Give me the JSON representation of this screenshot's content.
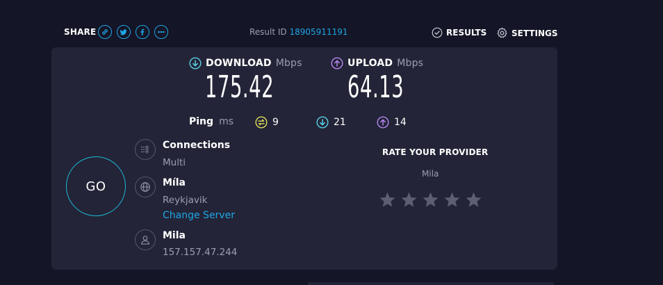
{
  "share": {
    "label": "SHARE",
    "buttons": [
      "link-icon",
      "twitter-icon",
      "facebook-icon",
      "more-icon"
    ]
  },
  "result": {
    "label": "Result ID",
    "id": "18905911191"
  },
  "nav": {
    "results": "RESULTS",
    "settings": "SETTINGS"
  },
  "download": {
    "label": "DOWNLOAD",
    "unit": "Mbps",
    "value": "175.42"
  },
  "upload": {
    "label": "UPLOAD",
    "unit": "Mbps",
    "value": "64.13"
  },
  "ping": {
    "label": "Ping",
    "unit": "ms",
    "idle": "9",
    "download": "21",
    "upload": "14"
  },
  "go_label": "GO",
  "connections": {
    "title": "Connections",
    "value": "Multi"
  },
  "server": {
    "name": "Míla",
    "location": "Reykjavik",
    "change_label": "Change Server"
  },
  "isp": {
    "name": "Mila",
    "ip": "157.157.47.244"
  },
  "rate": {
    "title": "RATE YOUR PROVIDER",
    "provider": "Mila",
    "stars": 5,
    "rating": 0
  },
  "colors": {
    "accent": "#1ea6e6",
    "download": "#5ad1e6",
    "upload": "#b787f0",
    "ping": "#e0e05a",
    "background": "#141526",
    "panel": "#232437"
  }
}
